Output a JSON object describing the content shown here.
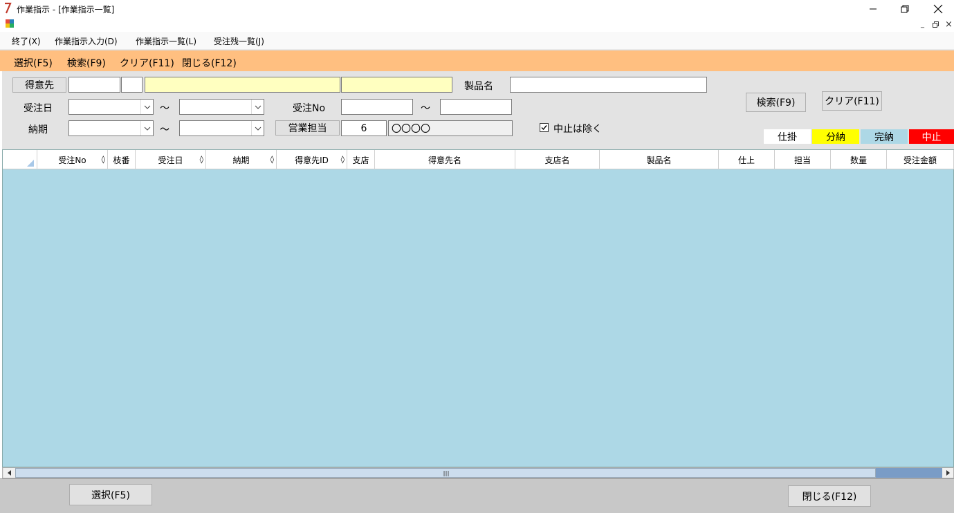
{
  "window": {
    "title": "作業指示 - [作業指示一覧]",
    "min_glyph": "—",
    "max_glyph": "⧉",
    "close_glyph": "✕"
  },
  "mdi": {
    "min": "_",
    "restore": "🗗",
    "close": "×"
  },
  "menu": {
    "items": [
      "終了(X)",
      "作業指示入力(D)",
      "作業指示一覧(L)",
      "受注残一覧(J)"
    ]
  },
  "fnbar": {
    "items": [
      "選択(F5)",
      "検索(F9)",
      "クリア(F11)",
      "閉じる(F12)"
    ]
  },
  "search": {
    "customer_button": "得意先",
    "customer_code": "",
    "customer_sub": "",
    "customer_name": "",
    "customer_branch": "",
    "product_label": "製品名",
    "product_value": "",
    "order_date_label": "受注日",
    "order_date_from": "",
    "order_date_to": "",
    "order_no_label": "受注No",
    "order_no_from": "",
    "order_no_to": "",
    "delivery_label": "納期",
    "delivery_from": "",
    "delivery_to": "",
    "tilde": "～",
    "sales_button": "営業担当",
    "sales_code": "6",
    "sales_name": "〇〇〇〇",
    "exclude_checkbox_label": "中止は除く",
    "exclude_checked": true,
    "search_button": "検索(F9)",
    "clear_button": "クリア(F11)"
  },
  "legend": [
    {
      "label": "仕掛",
      "bg": "#ffffff",
      "fg": "#000000"
    },
    {
      "label": "分納",
      "bg": "#ffff00",
      "fg": "#000000"
    },
    {
      "label": "完納",
      "bg": "#add8e6",
      "fg": "#000000"
    },
    {
      "label": "中止",
      "bg": "#ff0000",
      "fg": "#ffffff"
    }
  ],
  "grid": {
    "columns": [
      {
        "label": "受注No",
        "sortable": true
      },
      {
        "label": "枝番",
        "sortable": false
      },
      {
        "label": "受注日",
        "sortable": true
      },
      {
        "label": "納期",
        "sortable": true
      },
      {
        "label": "得意先ID",
        "sortable": true
      },
      {
        "label": "支店",
        "sortable": false
      },
      {
        "label": "得意先名",
        "sortable": false
      },
      {
        "label": "支店名",
        "sortable": false
      },
      {
        "label": "製品名",
        "sortable": false
      },
      {
        "label": "仕上",
        "sortable": false
      },
      {
        "label": "担当",
        "sortable": false
      },
      {
        "label": "数量",
        "sortable": false
      },
      {
        "label": "受注金額",
        "sortable": false
      }
    ],
    "sort_glyph": "◊",
    "rows": [],
    "background": "#add8e6"
  },
  "bottom": {
    "select_button": "選択(F5)",
    "close_button": "閉じる(F12)"
  }
}
